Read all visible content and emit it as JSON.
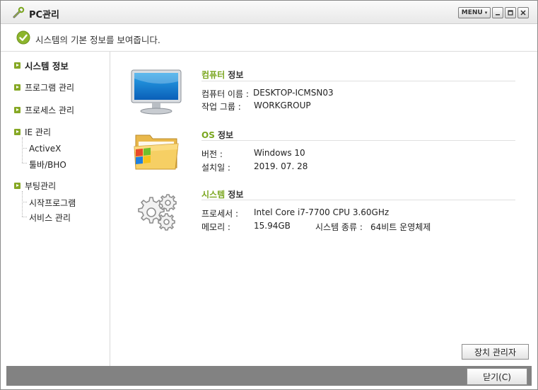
{
  "window": {
    "title": "PC관리",
    "menu_label": "MENU"
  },
  "info": {
    "message": "시스템의 기본 정보를 보여줍니다."
  },
  "sidebar": {
    "items": [
      {
        "label": "시스템 정보"
      },
      {
        "label": "프로그램 관리"
      },
      {
        "label": "프로세스 관리"
      },
      {
        "label": "IE 관리"
      },
      {
        "label": "ActiveX"
      },
      {
        "label": "툴바/BHO"
      },
      {
        "label": "부팅관리"
      },
      {
        "label": "시작프로그램"
      },
      {
        "label": "서비스 관리"
      }
    ]
  },
  "computer": {
    "title_hl": "컴퓨터",
    "title_rest": " 정보",
    "name_label": "컴퓨터 이름 :",
    "name_value": "DESKTOP-ICMSN03",
    "group_label": "작업 그룹 :",
    "group_value": "WORKGROUP"
  },
  "os": {
    "title_hl": "OS",
    "title_rest": " 정보",
    "version_label": "버전 :",
    "version_value": "Windows 10",
    "install_label": "설치일 :",
    "install_value": "2019. 07. 28"
  },
  "system": {
    "title_hl": "시스템",
    "title_rest": " 정보",
    "cpu_label": "프로세서 :",
    "cpu_value": "Intel Core i7-7700 CPU 3.60GHz",
    "mem_label": "메모리 :",
    "mem_value": "15.94GB",
    "type_label": "시스템 종류 :",
    "type_value": "64비트 운영체제"
  },
  "buttons": {
    "device_manager": "장치 관리자",
    "close": "닫기(C)"
  },
  "colors": {
    "accent": "#7aa61f",
    "bottom_bar": "#828282"
  }
}
